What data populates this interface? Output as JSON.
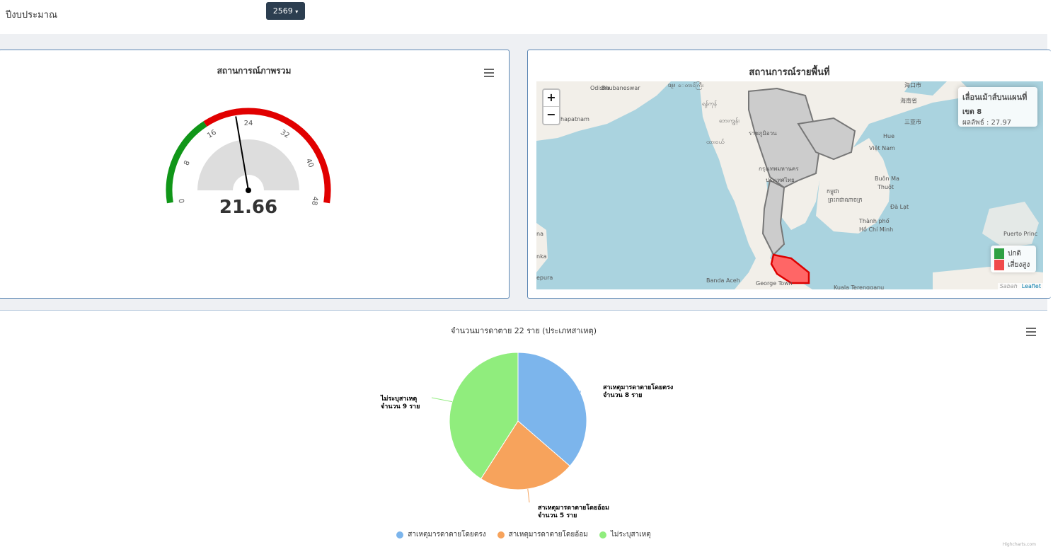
{
  "header": {
    "fiscal_year_label": "ปีงบประมาณ",
    "fiscal_year_value": "2569",
    "caret": "▾"
  },
  "overview": {
    "title": "สถานการณ์ภาพรวม",
    "gauge": {
      "value": 21.66,
      "display": "21.66",
      "min": 0,
      "max": 48,
      "normal_until": 16,
      "ticks": [
        "0",
        "8",
        "16",
        "24",
        "32",
        "40",
        "48"
      ],
      "colors": {
        "normal": "#109618",
        "risk": "#e10000",
        "inner": "#dddddd",
        "needle": "#000000"
      }
    }
  },
  "area": {
    "title": "สถานการณ์รายพื้นที่",
    "zoom_in": "+",
    "zoom_out": "−",
    "info": {
      "heading": "เลื่อนเม้าส์บนแผนที่",
      "zone": "เขต 8",
      "result": "ผลลัพธ์ : 27.97"
    },
    "legend": [
      {
        "label": "ปกติ",
        "color": "#2ea043"
      },
      {
        "label": "เสี่ยงสูง",
        "color": "#f04a4a"
      }
    ],
    "attribution": {
      "sabah": "Sabah",
      "leaflet": "Leaflet"
    },
    "places": [
      "Odisha",
      "Bhubaneswar",
      "ᥝᥨᥢ",
      "ေတာင်ကြီး",
      "海口市",
      "ရန်ကုန်",
      "海南省",
      "三亚市",
      "Hue",
      "Việt Nam",
      "hapatnam",
      "ထားဝယ်",
      "ဘေးကျွန်း",
      "ราชภูมิอวน",
      "กรุงเทพมหานคร",
      "ประเทศไทย",
      "Buôn Ma",
      "Thuột",
      "កម្ពុជា",
      "ព្រះរាជាណាចក្រ",
      "Đà Lạt",
      "Thành phố",
      "Hồ Chí Minh",
      "Puerto Princ",
      "Banda Aceh",
      "George Town",
      "Kuala Terengganu",
      "na",
      "nka",
      "epura"
    ]
  },
  "deaths_chart": {
    "title": "จำนวนมารดาตาย 22 ราย (ประเภทสาเหตุ)",
    "credits": "Highcharts.com",
    "chart_data": {
      "type": "pie",
      "title": "จำนวนมารดาตาย 22 ราย (ประเภทสาเหตุ)",
      "series": [
        {
          "name": "สาเหตุมารดาตายโดยตรง",
          "value": 8,
          "label": "จำนวน 8 ราย",
          "color": "#7cb5ec"
        },
        {
          "name": "สาเหตุมารดาตายโดยอ้อม",
          "value": 5,
          "label": "จำนวน 5 ราย",
          "color": "#f7a35c"
        },
        {
          "name": "ไม่ระบุสาเหตุ",
          "value": 9,
          "label": "จำนวน 9 ราย",
          "color": "#90ed7d"
        }
      ],
      "legend": "bottom-center"
    }
  }
}
